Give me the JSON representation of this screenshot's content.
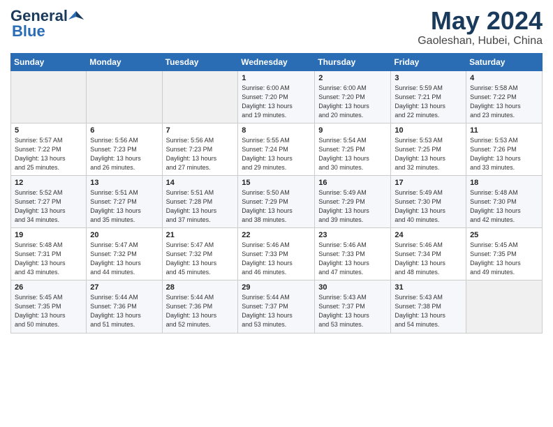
{
  "header": {
    "logo_general": "General",
    "logo_blue": "Blue",
    "month_year": "May 2024",
    "location": "Gaoleshan, Hubei, China"
  },
  "weekdays": [
    "Sunday",
    "Monday",
    "Tuesday",
    "Wednesday",
    "Thursday",
    "Friday",
    "Saturday"
  ],
  "weeks": [
    [
      {
        "day": "",
        "info": ""
      },
      {
        "day": "",
        "info": ""
      },
      {
        "day": "",
        "info": ""
      },
      {
        "day": "1",
        "info": "Sunrise: 6:00 AM\nSunset: 7:20 PM\nDaylight: 13 hours\nand 19 minutes."
      },
      {
        "day": "2",
        "info": "Sunrise: 6:00 AM\nSunset: 7:20 PM\nDaylight: 13 hours\nand 20 minutes."
      },
      {
        "day": "3",
        "info": "Sunrise: 5:59 AM\nSunset: 7:21 PM\nDaylight: 13 hours\nand 22 minutes."
      },
      {
        "day": "4",
        "info": "Sunrise: 5:58 AM\nSunset: 7:22 PM\nDaylight: 13 hours\nand 23 minutes."
      }
    ],
    [
      {
        "day": "5",
        "info": "Sunrise: 5:57 AM\nSunset: 7:22 PM\nDaylight: 13 hours\nand 25 minutes."
      },
      {
        "day": "6",
        "info": "Sunrise: 5:56 AM\nSunset: 7:23 PM\nDaylight: 13 hours\nand 26 minutes."
      },
      {
        "day": "7",
        "info": "Sunrise: 5:56 AM\nSunset: 7:23 PM\nDaylight: 13 hours\nand 27 minutes."
      },
      {
        "day": "8",
        "info": "Sunrise: 5:55 AM\nSunset: 7:24 PM\nDaylight: 13 hours\nand 29 minutes."
      },
      {
        "day": "9",
        "info": "Sunrise: 5:54 AM\nSunset: 7:25 PM\nDaylight: 13 hours\nand 30 minutes."
      },
      {
        "day": "10",
        "info": "Sunrise: 5:53 AM\nSunset: 7:25 PM\nDaylight: 13 hours\nand 32 minutes."
      },
      {
        "day": "11",
        "info": "Sunrise: 5:53 AM\nSunset: 7:26 PM\nDaylight: 13 hours\nand 33 minutes."
      }
    ],
    [
      {
        "day": "12",
        "info": "Sunrise: 5:52 AM\nSunset: 7:27 PM\nDaylight: 13 hours\nand 34 minutes."
      },
      {
        "day": "13",
        "info": "Sunrise: 5:51 AM\nSunset: 7:27 PM\nDaylight: 13 hours\nand 35 minutes."
      },
      {
        "day": "14",
        "info": "Sunrise: 5:51 AM\nSunset: 7:28 PM\nDaylight: 13 hours\nand 37 minutes."
      },
      {
        "day": "15",
        "info": "Sunrise: 5:50 AM\nSunset: 7:29 PM\nDaylight: 13 hours\nand 38 minutes."
      },
      {
        "day": "16",
        "info": "Sunrise: 5:49 AM\nSunset: 7:29 PM\nDaylight: 13 hours\nand 39 minutes."
      },
      {
        "day": "17",
        "info": "Sunrise: 5:49 AM\nSunset: 7:30 PM\nDaylight: 13 hours\nand 40 minutes."
      },
      {
        "day": "18",
        "info": "Sunrise: 5:48 AM\nSunset: 7:30 PM\nDaylight: 13 hours\nand 42 minutes."
      }
    ],
    [
      {
        "day": "19",
        "info": "Sunrise: 5:48 AM\nSunset: 7:31 PM\nDaylight: 13 hours\nand 43 minutes."
      },
      {
        "day": "20",
        "info": "Sunrise: 5:47 AM\nSunset: 7:32 PM\nDaylight: 13 hours\nand 44 minutes."
      },
      {
        "day": "21",
        "info": "Sunrise: 5:47 AM\nSunset: 7:32 PM\nDaylight: 13 hours\nand 45 minutes."
      },
      {
        "day": "22",
        "info": "Sunrise: 5:46 AM\nSunset: 7:33 PM\nDaylight: 13 hours\nand 46 minutes."
      },
      {
        "day": "23",
        "info": "Sunrise: 5:46 AM\nSunset: 7:33 PM\nDaylight: 13 hours\nand 47 minutes."
      },
      {
        "day": "24",
        "info": "Sunrise: 5:46 AM\nSunset: 7:34 PM\nDaylight: 13 hours\nand 48 minutes."
      },
      {
        "day": "25",
        "info": "Sunrise: 5:45 AM\nSunset: 7:35 PM\nDaylight: 13 hours\nand 49 minutes."
      }
    ],
    [
      {
        "day": "26",
        "info": "Sunrise: 5:45 AM\nSunset: 7:35 PM\nDaylight: 13 hours\nand 50 minutes."
      },
      {
        "day": "27",
        "info": "Sunrise: 5:44 AM\nSunset: 7:36 PM\nDaylight: 13 hours\nand 51 minutes."
      },
      {
        "day": "28",
        "info": "Sunrise: 5:44 AM\nSunset: 7:36 PM\nDaylight: 13 hours\nand 52 minutes."
      },
      {
        "day": "29",
        "info": "Sunrise: 5:44 AM\nSunset: 7:37 PM\nDaylight: 13 hours\nand 53 minutes."
      },
      {
        "day": "30",
        "info": "Sunrise: 5:43 AM\nSunset: 7:37 PM\nDaylight: 13 hours\nand 53 minutes."
      },
      {
        "day": "31",
        "info": "Sunrise: 5:43 AM\nSunset: 7:38 PM\nDaylight: 13 hours\nand 54 minutes."
      },
      {
        "day": "",
        "info": ""
      }
    ]
  ]
}
